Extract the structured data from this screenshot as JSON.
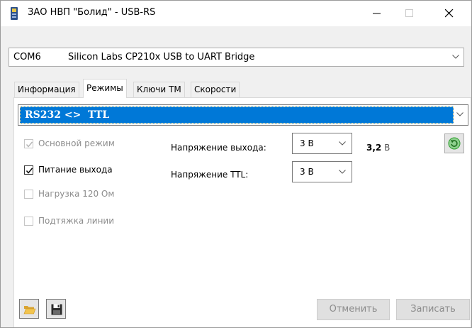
{
  "window": {
    "title": "ЗАО НВП \"Болид\" - USB-RS"
  },
  "port": {
    "name": "COM6",
    "description": "Silicon Labs CP210x USB to UART Bridge"
  },
  "tabs": [
    {
      "label": "Информация",
      "active": false
    },
    {
      "label": "Режимы",
      "active": true
    },
    {
      "label": "Ключи ТМ",
      "active": false
    },
    {
      "label": "Скорости",
      "active": false
    }
  ],
  "mode": {
    "selected": "RS232 <>  TTL "
  },
  "options": {
    "main_mode": {
      "label": "Основной режим",
      "checked": true,
      "enabled": false
    },
    "power_output": {
      "label": "Питание выхода",
      "checked": true,
      "enabled": true
    },
    "load_120": {
      "label": "Нагрузка 120 Ом",
      "checked": false,
      "enabled": false
    },
    "line_pullup": {
      "label": "Подтяжка линии",
      "checked": false,
      "enabled": false
    }
  },
  "voltage": {
    "output_label": "Напряжение выхода:",
    "output_value": "3 В",
    "measured_value": "3,2",
    "measured_unit": "В",
    "ttl_label": "Напряжение TTL:",
    "ttl_value": "3 В"
  },
  "buttons": {
    "cancel_label": "Отменить",
    "write_label": "Записать"
  },
  "colors": {
    "selection": "#0078d7",
    "refresh_green": "#2e9e2e",
    "folder_yellow": "#f2c44d"
  }
}
